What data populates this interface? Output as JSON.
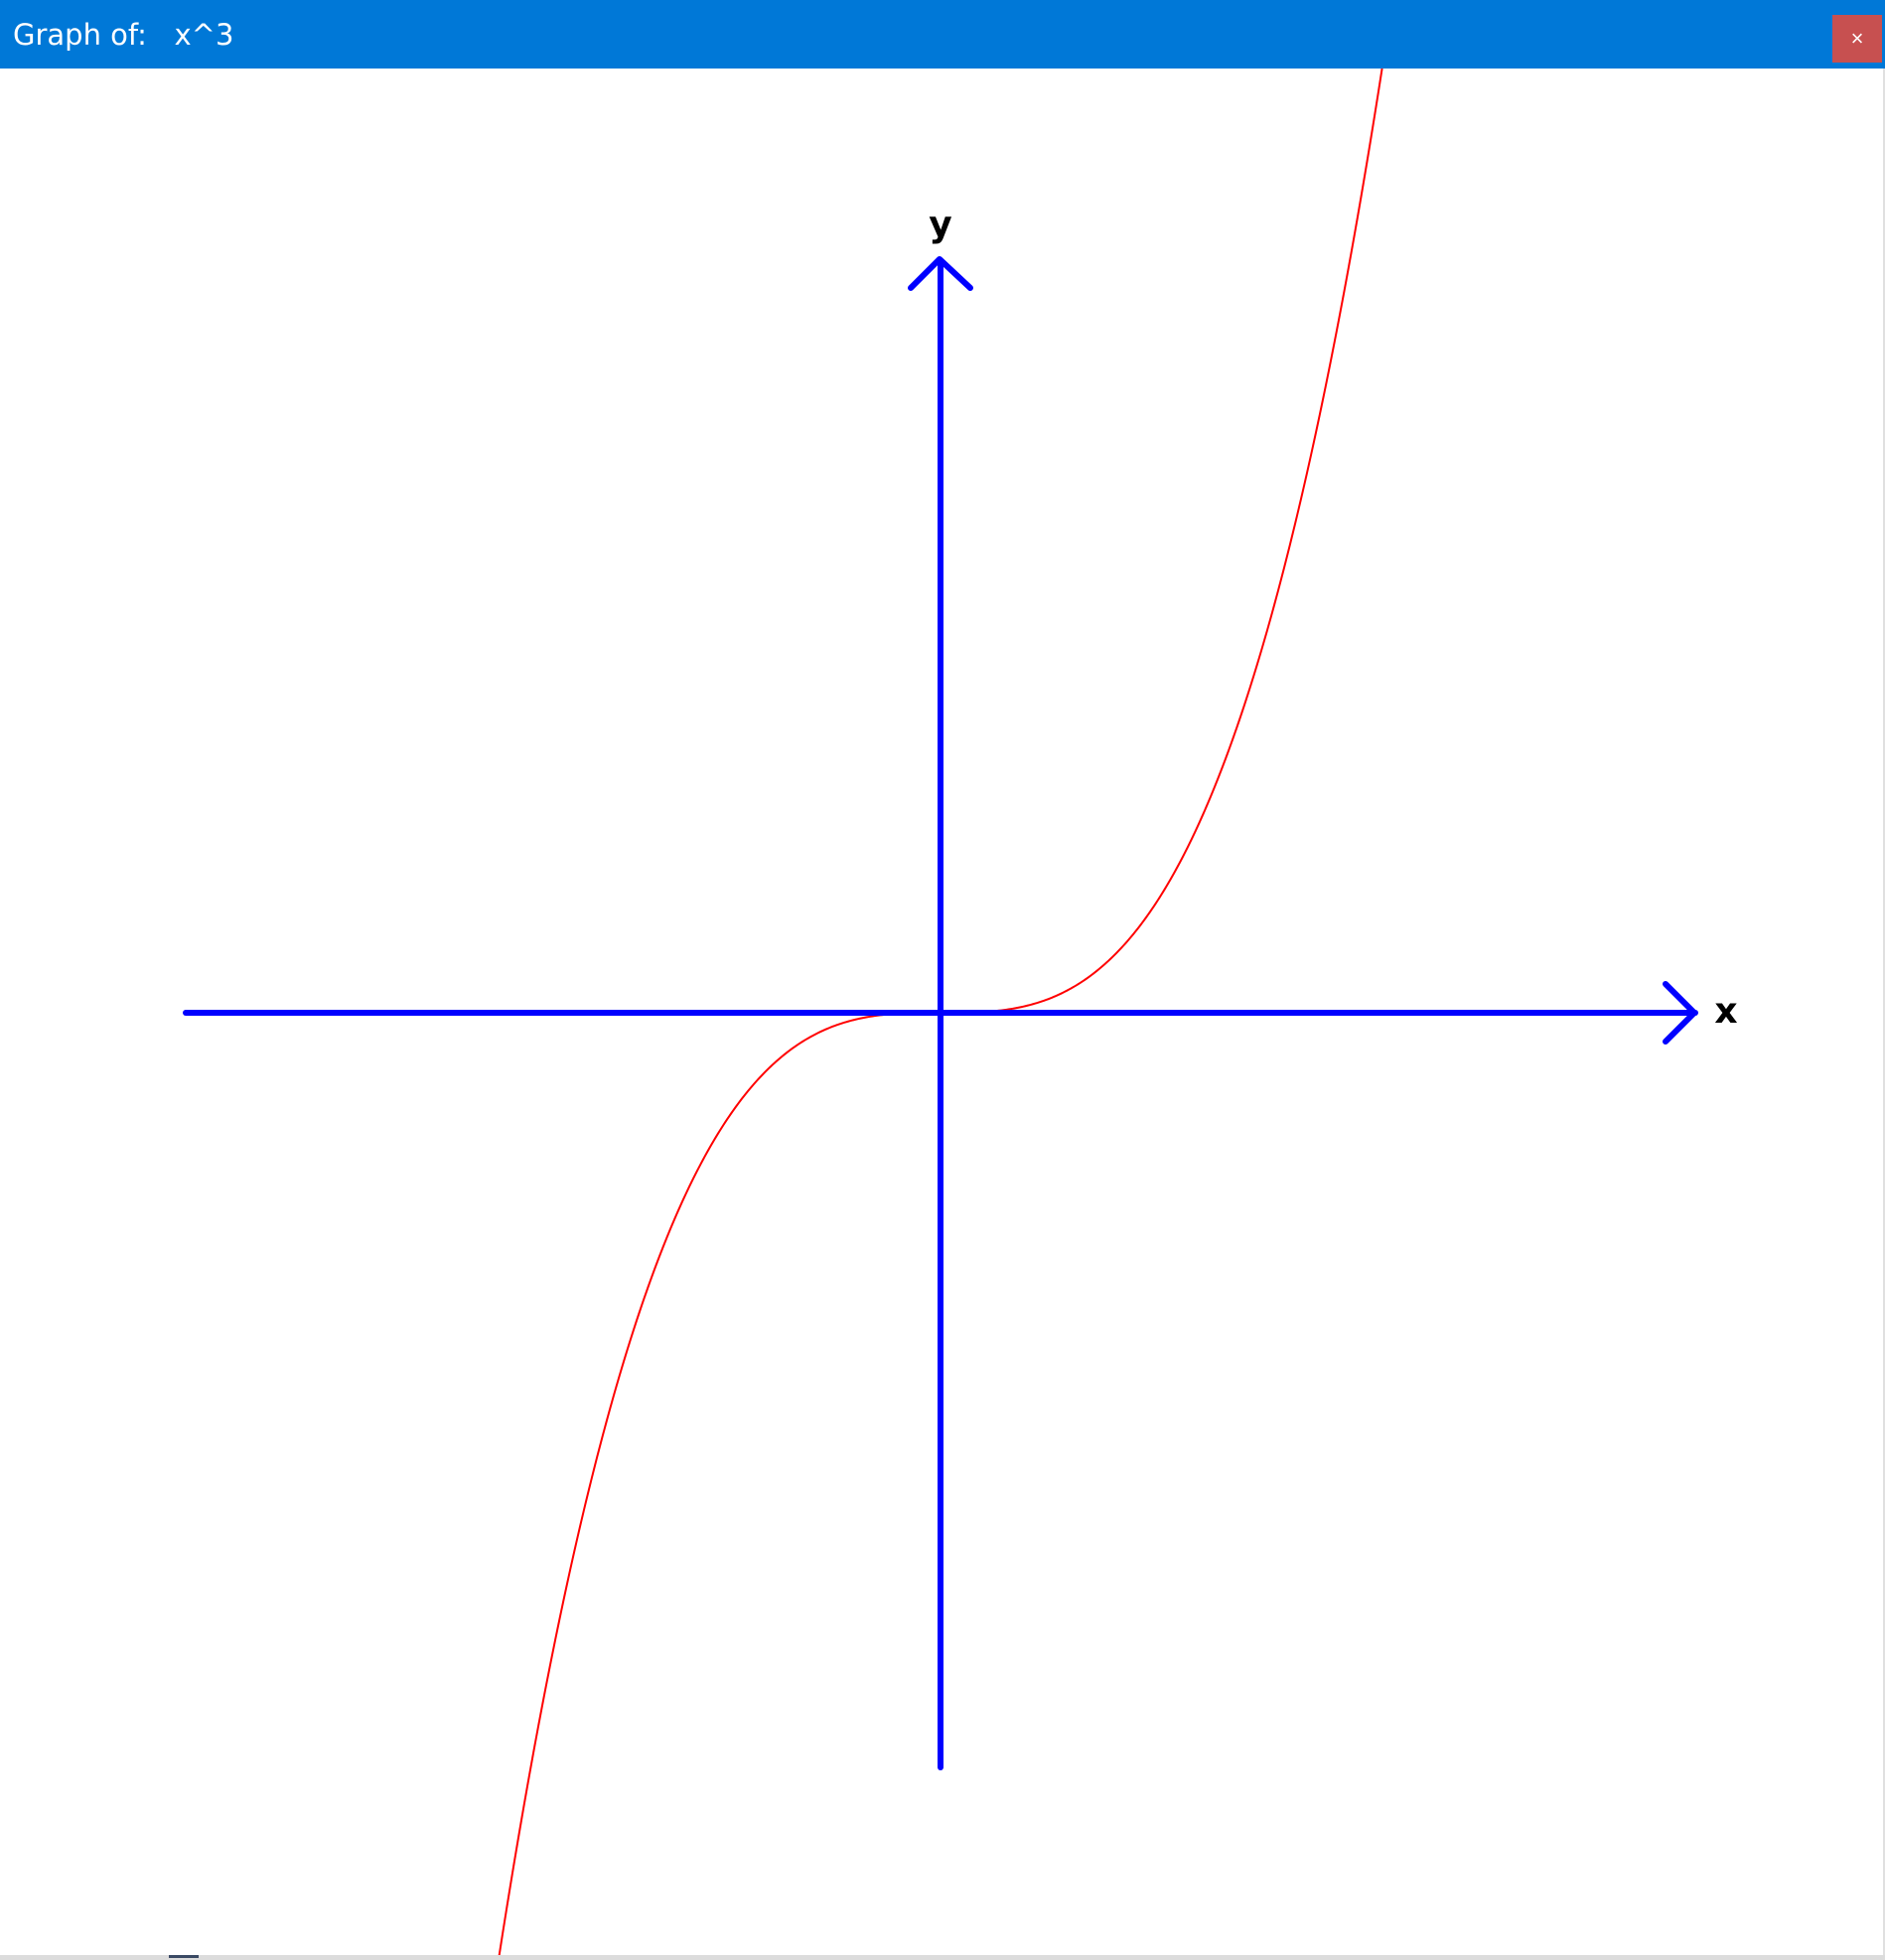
{
  "window": {
    "title": "Graph of:   x^3",
    "close_label": "×"
  },
  "colors": {
    "titlebar": "#0078d7",
    "close": "#c75050",
    "axes": "#0000ff",
    "curve": "#ff0000",
    "label": "#000000"
  },
  "chart_data": {
    "type": "line",
    "function": "x^3",
    "xlabel": "x",
    "ylabel": "y",
    "xlim": [
      -2.5,
      2.5
    ],
    "ylim": [
      -2.5,
      2.5
    ],
    "grid": false,
    "series": [
      {
        "values_fn": "x^3"
      }
    ]
  }
}
